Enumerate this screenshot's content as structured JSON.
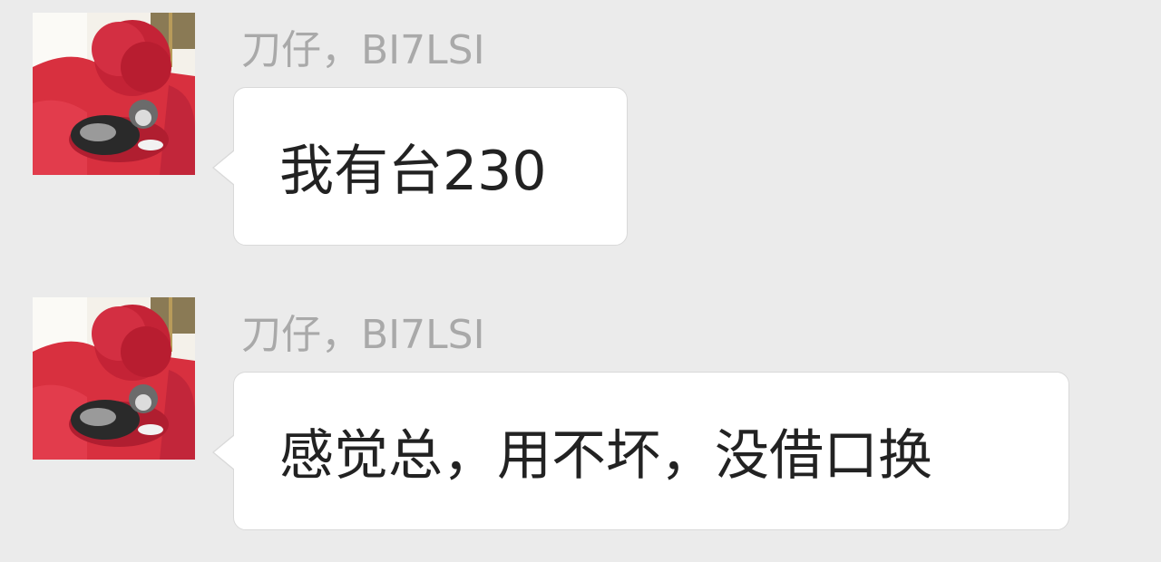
{
  "messages": [
    {
      "sender": "刀仔，BI7LSI",
      "text": "我有台230",
      "avatar_icon": "cat-on-red-sofa-avatar"
    },
    {
      "sender": "刀仔，BI7LSI",
      "text": "感觉总，用不坏，没借口换",
      "avatar_icon": "cat-on-red-sofa-avatar"
    }
  ],
  "colors": {
    "background": "#ebebeb",
    "bubble": "#ffffff",
    "sender_text": "#a9a9a9",
    "message_text": "#222222",
    "avatar_red": "#d23a48"
  }
}
